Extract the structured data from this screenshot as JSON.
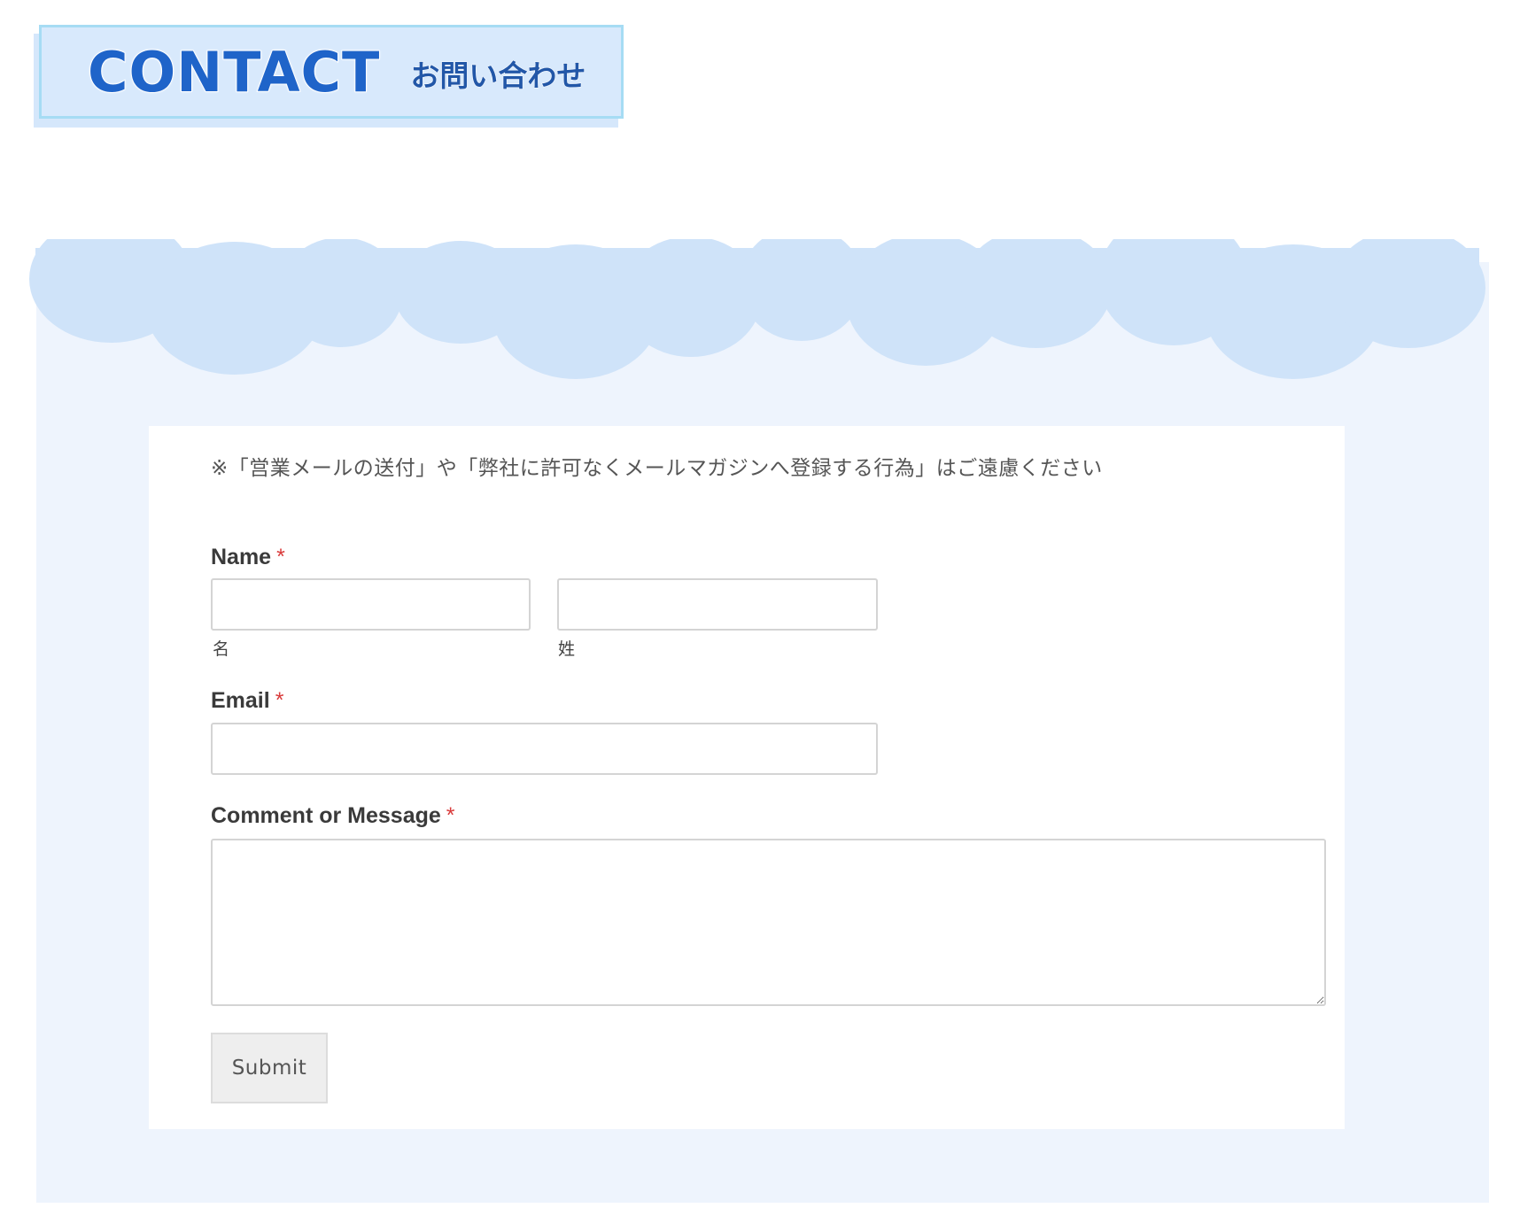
{
  "header": {
    "title": "CONTACT",
    "subtitle": "お問い合わせ"
  },
  "form": {
    "notice": "※「営業メールの送付」や「弊社に許可なくメールマガジンへ登録する行為」はご遠慮ください",
    "required_mark": "*",
    "name": {
      "label": "Name",
      "first_sublabel": "名",
      "last_sublabel": "姓",
      "first_value": "",
      "last_value": ""
    },
    "email": {
      "label": "Email",
      "value": ""
    },
    "message": {
      "label": "Comment or Message",
      "value": ""
    },
    "submit_label": "Submit"
  },
  "colors": {
    "accent": "#1f64c9",
    "cloud": "#cfe3f9",
    "section_bg": "#eef4fd",
    "required": "#d93b3b"
  }
}
